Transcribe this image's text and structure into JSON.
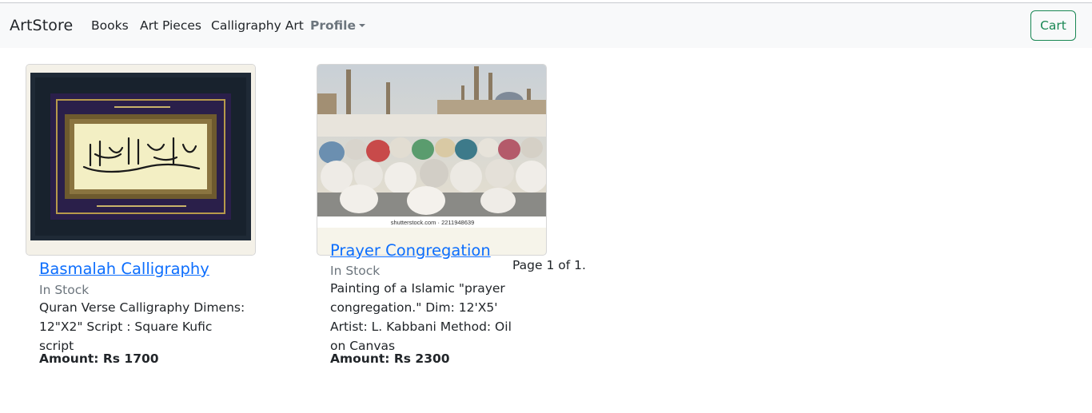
{
  "navbar": {
    "brand": "ArtStore",
    "links": [
      "Books",
      "Art Pieces",
      "Calligraphy Art"
    ],
    "profile_label": "Profile",
    "cart_label": "Cart",
    "cart_color": "#198754",
    "link_color": "#0d6efd"
  },
  "products": [
    {
      "title": "Basmalah Calligraphy",
      "stock": "In Stock",
      "description": "Quran Verse Calligraphy Dimens: 12\"X2\" Script : Square Kufic script",
      "amount": "Amount: Rs 1700"
    },
    {
      "title": "Prayer Congregation",
      "stock": "In Stock",
      "description": "Painting of a Islamic \"prayer congregation.\" Dim: 12'X5' Artist: L. Kabbani Method: Oil on Canvas",
      "amount": "Amount: Rs 2300",
      "image_caption": "shutterstock.com · 2211948639"
    }
  ],
  "pagination": {
    "text": "Page 1 of 1."
  }
}
